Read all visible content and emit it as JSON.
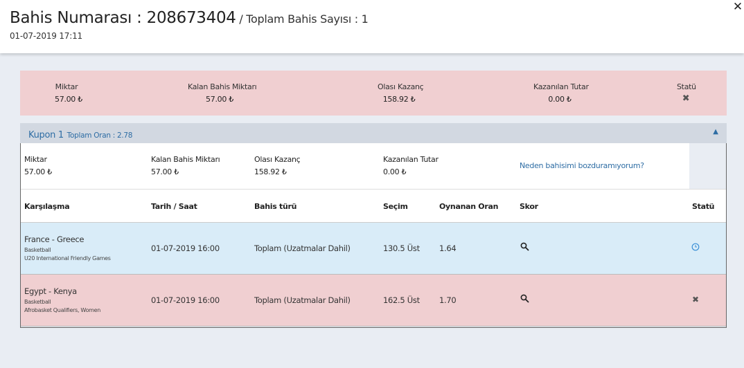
{
  "header": {
    "title_main": "Bahis Numarası : 208673404",
    "title_sub": "/ Toplam Bahis Sayısı : 1",
    "date": "01-07-2019 17:11",
    "close_icon": "close-icon"
  },
  "summary": {
    "amount_label": "Miktar",
    "amount_value": "57.00 ₺",
    "remaining_label": "Kalan Bahis Miktarı",
    "remaining_value": "57.00 ₺",
    "potential_label": "Olası Kazanç",
    "potential_value": "158.92 ₺",
    "won_label": "Kazanılan Tutar",
    "won_value": "0.00 ₺",
    "status_label": "Statü",
    "status_icon": "x-icon"
  },
  "coupon": {
    "title": "Kupon 1",
    "total_odds": "Toplam Oran : 2.78",
    "info": {
      "amount_label": "Miktar",
      "amount_value": "57.00 ₺",
      "remaining_label": "Kalan Bahis Miktarı",
      "remaining_value": "57.00 ₺",
      "potential_label": "Olası Kazanç",
      "potential_value": "158.92 ₺",
      "won_label": "Kazanılan Tutar",
      "won_value": "0.00 ₺",
      "cashout_link": "Neden bahisimi bozduramıyorum?"
    },
    "columns": [
      "Karşılaşma",
      "Tarih / Saat",
      "Bahis türü",
      "Seçim",
      "Oynanan Oran",
      "Skor",
      "Statü"
    ],
    "rows": [
      {
        "teams": "France - Greece",
        "sport": "Basketball",
        "league": "U20 International Friendly Games",
        "datetime": "01-07-2019 16:00",
        "bet_type": "Toplam (Uzatmalar Dahil)",
        "selection": "130.5 Üst",
        "odds": "1.64",
        "score_icon": "search-icon",
        "status_icon": "clock-icon",
        "status_color": "#3a8fd6"
      },
      {
        "teams": "Egypt - Kenya",
        "sport": "Basketball",
        "league": "Afrobasket Qualifiers, Women",
        "datetime": "01-07-2019 16:00",
        "bet_type": "Toplam (Uzatmalar Dahil)",
        "selection": "162.5 Üst",
        "odds": "1.70",
        "score_icon": "search-icon",
        "status_icon": "x-icon",
        "status_color": "#555555"
      }
    ]
  },
  "colors": {
    "accent": "#2e6da4",
    "lost_bg": "#f0cfd1",
    "pending_bg": "#d9ecf8",
    "page_bg": "#e9edf3"
  }
}
